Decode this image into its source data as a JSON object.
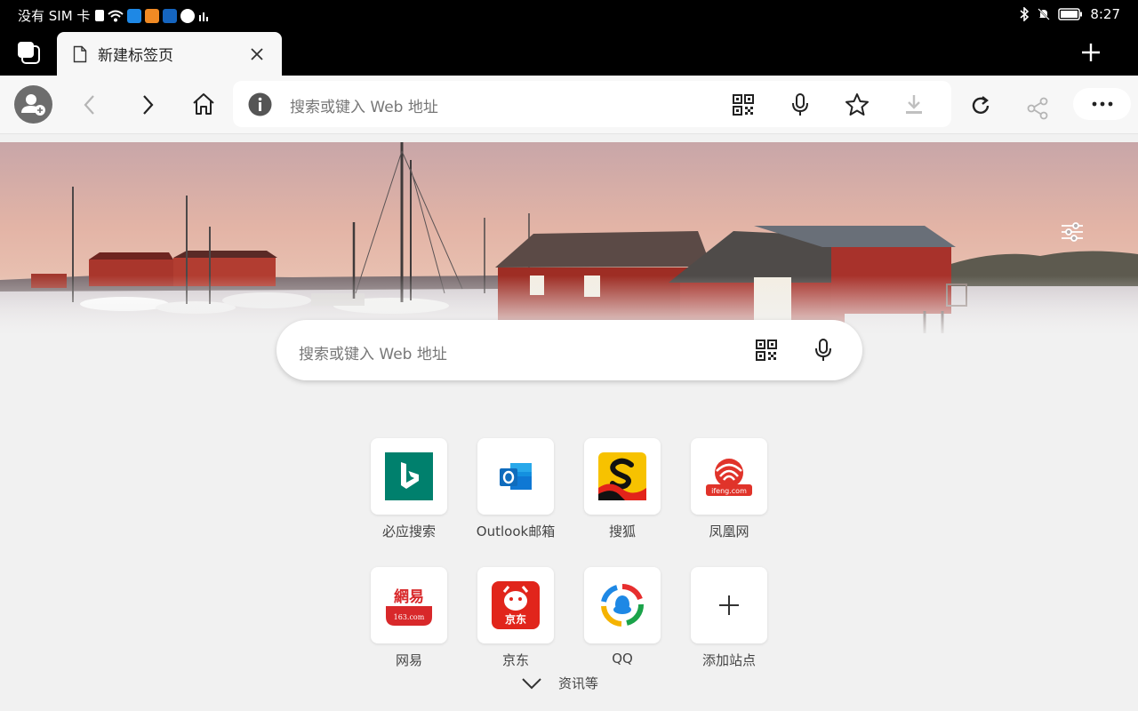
{
  "status_bar": {
    "carrier": "没有 SIM 卡",
    "time": "8:27"
  },
  "tab": {
    "title": "新建标签页"
  },
  "toolbar": {
    "address_placeholder": "搜索或键入 Web 地址"
  },
  "search": {
    "placeholder": "搜索或键入 Web 地址"
  },
  "tiles": [
    {
      "label": "必应搜索",
      "icon": "bing-icon"
    },
    {
      "label": "Outlook邮箱",
      "icon": "outlook-icon"
    },
    {
      "label": "搜狐",
      "icon": "sohu-icon"
    },
    {
      "label": "凤凰网",
      "icon": "ifeng-icon"
    },
    {
      "label": "网易",
      "icon": "netease-icon"
    },
    {
      "label": "京东",
      "icon": "jd-icon"
    },
    {
      "label": "QQ",
      "icon": "qq-icon"
    },
    {
      "label": "添加站点",
      "icon": "plus-icon"
    }
  ],
  "tile_logo_text": {
    "ifeng": "ifeng.com",
    "netease": "網易",
    "netease_sub": "163.com",
    "jd": "京东"
  },
  "footer": {
    "more_label": "资讯等"
  },
  "colors": {
    "bing": "#00806d",
    "outlook": "#0f6cbd",
    "sohu": "#f7c200",
    "ifeng": "#e0332a",
    "netease": "#d8282a",
    "jd": "#e1251b"
  }
}
